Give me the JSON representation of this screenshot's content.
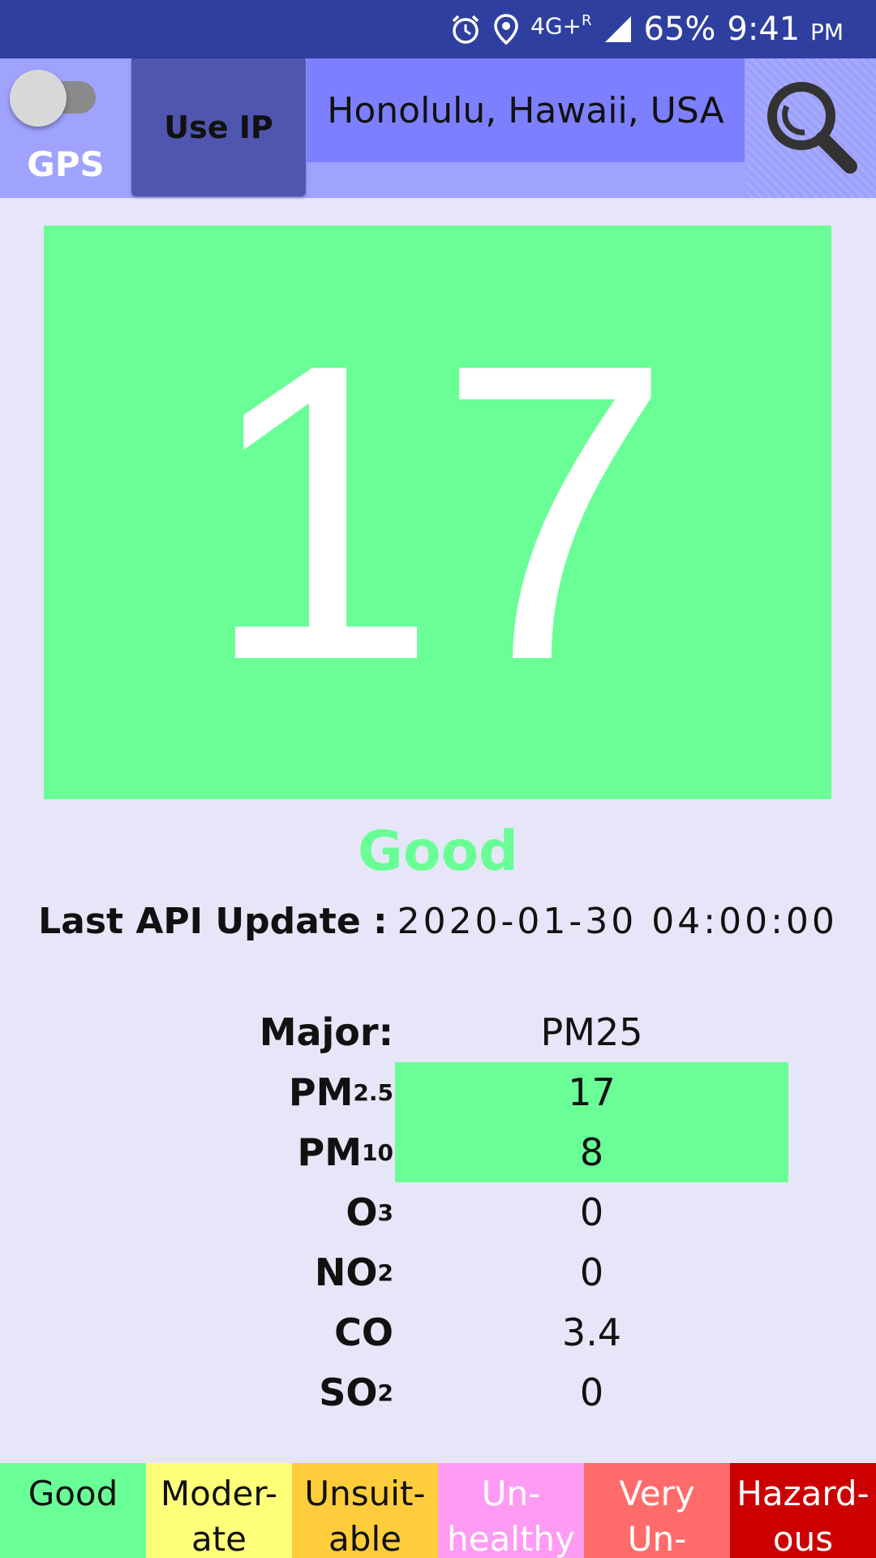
{
  "status_bar": {
    "network": "4G+",
    "roaming": "R",
    "battery": "65%",
    "time": "9:41",
    "ampm": "PM",
    "icons": [
      "alarm-icon",
      "location-pin-icon",
      "signal-icon"
    ]
  },
  "toolbar": {
    "gps_label": "GPS",
    "gps_enabled": false,
    "use_ip_label": "Use IP",
    "location": "Honolulu, Hawaii, USA",
    "search_icon": "search-icon"
  },
  "aqi": {
    "value": "17",
    "status": "Good",
    "color": "#69ff96"
  },
  "update": {
    "label": "Last API Update :",
    "value": "2020-01-30  04:00:00"
  },
  "pollutants": {
    "major_label": "Major:",
    "major_value": "PM25",
    "rows": [
      {
        "name": "PM",
        "sub": "2.5",
        "value": "17",
        "highlight": true
      },
      {
        "name": "PM",
        "sub": "10",
        "value": "8",
        "highlight": true
      },
      {
        "name": "O",
        "sub": "3",
        "value": "0",
        "highlight": false
      },
      {
        "name": "NO",
        "sub": "2",
        "value": "0",
        "highlight": false
      },
      {
        "name": "CO",
        "sub": "",
        "value": "3.4",
        "highlight": false
      },
      {
        "name": "SO",
        "sub": "2",
        "value": "0",
        "highlight": false
      }
    ]
  },
  "legend": [
    {
      "line1": "Good",
      "line2": "",
      "bg": "#69ff96",
      "fg": "#111111"
    },
    {
      "line1": "Moder-",
      "line2": "ate",
      "bg": "#ffff7a",
      "fg": "#111111"
    },
    {
      "line1": "Unsuit-",
      "line2": "able",
      "bg": "#ffcc3c",
      "fg": "#111111"
    },
    {
      "line1": "Un-",
      "line2": "healthy",
      "bg": "#ff9bf3",
      "fg": "#ffffff"
    },
    {
      "line1": "Very",
      "line2": "Un-",
      "bg": "#ff6b6b",
      "fg": "#ffffff"
    },
    {
      "line1": "Hazard-",
      "line2": "ous",
      "bg": "#cc0000",
      "fg": "#ffffff"
    }
  ]
}
